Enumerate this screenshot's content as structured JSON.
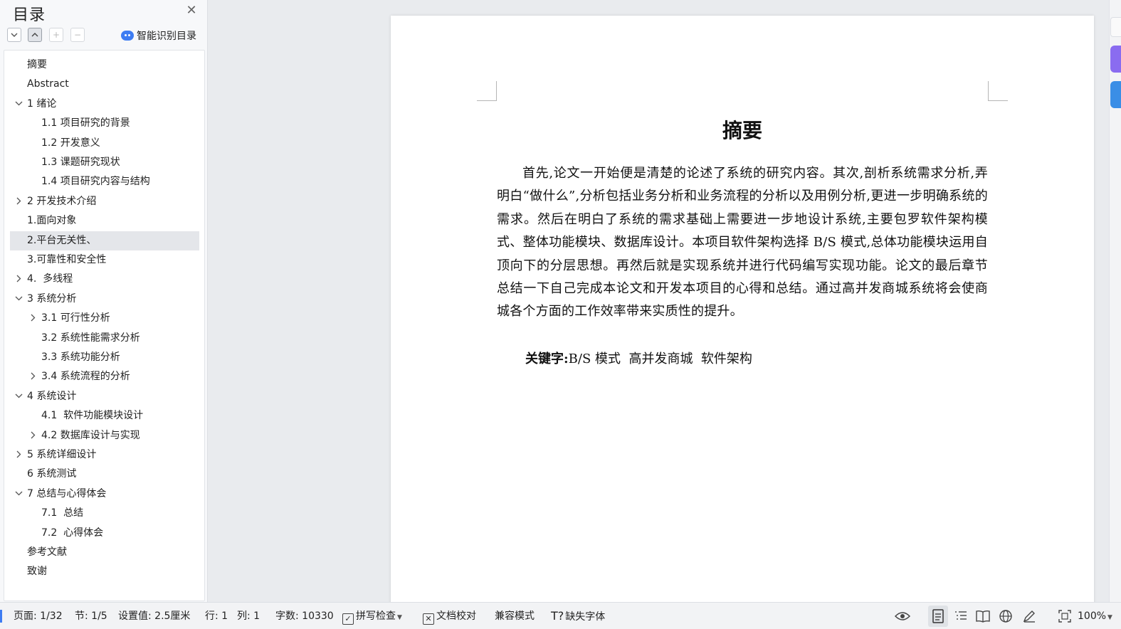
{
  "sidebar": {
    "title": "目录",
    "close_icon": "close-icon",
    "tools": [
      "expand-all-icon",
      "collapse-all-icon",
      "add-heading-icon",
      "remove-heading-icon"
    ],
    "smart_button": "智能识别目录",
    "items": [
      {
        "label": "摘要",
        "level": 1,
        "arrow": ""
      },
      {
        "label": "Abstract",
        "level": 1,
        "arrow": ""
      },
      {
        "label": "1 绪论",
        "level": 1,
        "arrow": "expanded"
      },
      {
        "label": "1.1 项目研究的背景",
        "level": 2,
        "arrow": ""
      },
      {
        "label": "1.2 开发意义",
        "level": 2,
        "arrow": ""
      },
      {
        "label": "1.3 课题研究现状",
        "level": 2,
        "arrow": ""
      },
      {
        "label": "1.4 项目研究内容与结构",
        "level": 2,
        "arrow": ""
      },
      {
        "label": "2 开发技术介绍",
        "level": 1,
        "arrow": "collapsed"
      },
      {
        "label": "1.面向对象",
        "level": 1,
        "arrow": ""
      },
      {
        "label": "2.平台无关性、",
        "level": 1,
        "arrow": "",
        "selected": true
      },
      {
        "label": "3.可靠性和安全性",
        "level": 1,
        "arrow": ""
      },
      {
        "label": "4.  多线程",
        "level": 1,
        "arrow": "collapsed"
      },
      {
        "label": "3 系统分析",
        "level": 1,
        "arrow": "expanded"
      },
      {
        "label": "3.1 可行性分析",
        "level": 2,
        "arrow": "collapsed"
      },
      {
        "label": "3.2 系统性能需求分析",
        "level": 2,
        "arrow": ""
      },
      {
        "label": "3.3 系统功能分析",
        "level": 2,
        "arrow": ""
      },
      {
        "label": "3.4 系统流程的分析",
        "level": 2,
        "arrow": "collapsed"
      },
      {
        "label": "4 系统设计",
        "level": 1,
        "arrow": "expanded"
      },
      {
        "label": "4.1  软件功能模块设计",
        "level": 2,
        "arrow": ""
      },
      {
        "label": "4.2 数据库设计与实现",
        "level": 2,
        "arrow": "collapsed"
      },
      {
        "label": "5 系统详细设计",
        "level": 1,
        "arrow": "collapsed"
      },
      {
        "label": "6 系统测试",
        "level": 1,
        "arrow": ""
      },
      {
        "label": "7 总结与心得体会",
        "level": 1,
        "arrow": "expanded"
      },
      {
        "label": "7.1  总结",
        "level": 2,
        "arrow": ""
      },
      {
        "label": "7.2  心得体会",
        "level": 2,
        "arrow": ""
      },
      {
        "label": "参考文献",
        "level": 1,
        "arrow": ""
      },
      {
        "label": "致谢",
        "level": 1,
        "arrow": ""
      }
    ]
  },
  "document": {
    "title": "摘要",
    "paragraph": "首先,论文一开始便是清楚的论述了系统的研究内容。其次,剖析系统需求分析,弄明白“做什么”,分析包括业务分析和业务流程的分析以及用例分析,更进一步明确系统的需求。然后在明白了系统的需求基础上需要进一步地设计系统,主要包罗软件架构模式、整体功能模块、数据库设计。本项目软件架构选择 B/S 模式,总体功能模块运用自顶向下的分层思想。再然后就是实现系统并进行代码编写实现功能。论文的最后章节总结一下自己完成本论文和开发本项目的心得和总结。通过高并发商城系统将会使商城各个方面的工作效率带来实质性的提升。",
    "keywords_label": "关键字:",
    "keywords_value": "B/S 模式  高并发商城  软件架构"
  },
  "statusbar": {
    "page": "页面: 1/32",
    "section": "节: 1/5",
    "setting": "设置值: 2.5厘米",
    "row": "行: 1",
    "col": "列: 1",
    "words": "字数: 10330",
    "spellcheck": "拼写检查",
    "proofread": "文档校对",
    "compat": "兼容模式",
    "missing_font": "缺失字体",
    "zoom": "100%"
  },
  "colors": {
    "accent_blue": "#3d7cf2",
    "edge_purple": "#8a6cf0",
    "edge_blue": "#3a8ee6",
    "selection": "#e4e6ea"
  }
}
